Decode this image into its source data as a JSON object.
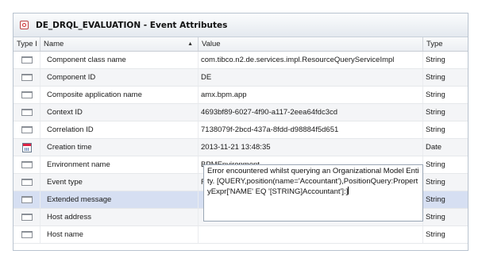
{
  "panel": {
    "title": "DE_DRQL_EVALUATION - Event Attributes"
  },
  "columns": {
    "type_icon": "Type I",
    "name": "Name",
    "value": "Value",
    "type": "Type"
  },
  "rows": [
    {
      "name": "Component class name",
      "value": "com.tibco.n2.de.services.impl.ResourceQueryServiceImpl",
      "type": "String",
      "icon": "attribute-icon"
    },
    {
      "name": "Component ID",
      "value": "DE",
      "type": "String",
      "icon": "attribute-icon"
    },
    {
      "name": "Composite application name",
      "value": "amx.bpm.app",
      "type": "String",
      "icon": "attribute-icon"
    },
    {
      "name": "Context ID",
      "value": "4693bf89-6027-4f90-a117-2eea64fdc3cd",
      "type": "String",
      "icon": "attribute-icon"
    },
    {
      "name": "Correlation ID",
      "value": "7138079f-2bcd-437a-8fdd-d98884f5d651",
      "type": "String",
      "icon": "attribute-icon"
    },
    {
      "name": "Creation time",
      "value": "2013-11-21 13:48:35",
      "type": "Date",
      "icon": "calendar-icon"
    },
    {
      "name": "Environment name",
      "value": "BPMEnvironment",
      "type": "String",
      "icon": "attribute-icon"
    },
    {
      "name": "Event type",
      "value": "FAULT",
      "type": "String",
      "icon": "attribute-icon"
    },
    {
      "name": "Extended message",
      "value": "",
      "type": "String",
      "icon": "attribute-icon"
    },
    {
      "name": "Host address",
      "value": "",
      "type": "String",
      "icon": "attribute-icon"
    },
    {
      "name": "Host name",
      "value": "",
      "type": "String",
      "icon": "attribute-icon"
    }
  ],
  "editor": {
    "text": "Error encountered whilst querying an Organizational Model Entity. [QUERY,position(name='Accountant'),PositionQuery:PropertyExpr['NAME' EQ '[STRING]Accountant']:]"
  }
}
